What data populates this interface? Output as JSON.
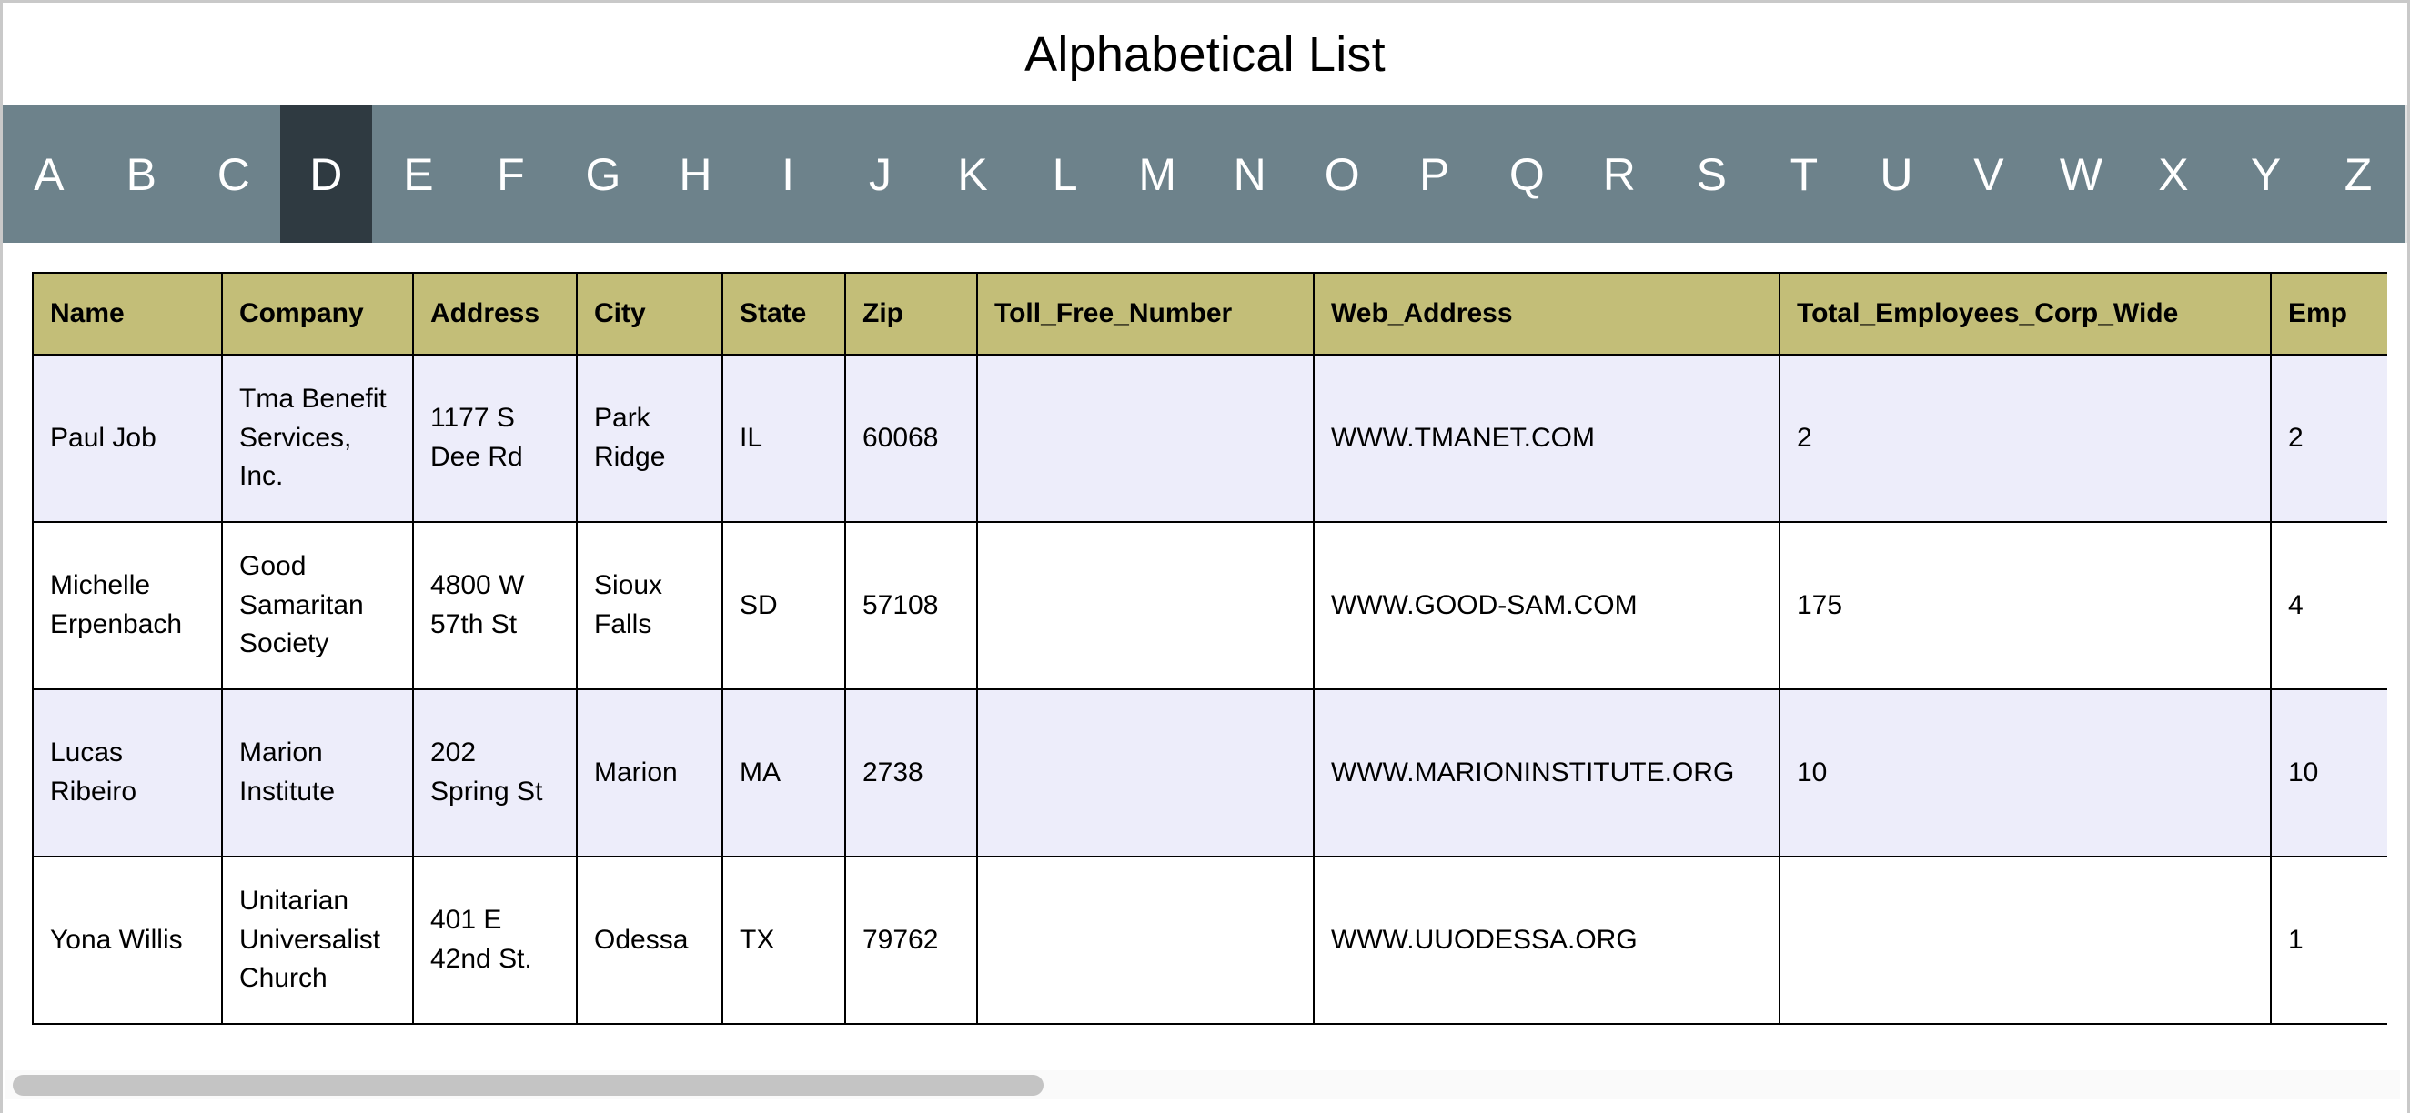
{
  "header": {
    "title": "Alphabetical List"
  },
  "alphabet_nav": {
    "active_letter": "D",
    "letters": [
      "A",
      "B",
      "C",
      "D",
      "E",
      "F",
      "G",
      "H",
      "I",
      "J",
      "K",
      "L",
      "M",
      "N",
      "O",
      "P",
      "Q",
      "R",
      "S",
      "T",
      "U",
      "V",
      "W",
      "X",
      "Y",
      "Z"
    ]
  },
  "table": {
    "columns": [
      "Name",
      "Company",
      "Address",
      "City",
      "State",
      "Zip",
      "Toll_Free_Number",
      "Web_Address",
      "Total_Employees_Corp_Wide",
      "Emp"
    ],
    "rows": [
      {
        "name": "Paul Job",
        "company": "Tma Benefit Services, Inc.",
        "address": "1177 S Dee Rd",
        "city": "Park Ridge",
        "state": "IL",
        "zip": "60068",
        "toll_free_number": "",
        "web_address": "WWW.TMANET.COM",
        "total_employees_corp_wide": "2",
        "emp": "2"
      },
      {
        "name": "Michelle Erpenbach",
        "company": "Good Samaritan Society",
        "address": "4800 W 57th St",
        "city": "Sioux Falls",
        "state": "SD",
        "zip": "57108",
        "toll_free_number": "",
        "web_address": "WWW.GOOD-SAM.COM",
        "total_employees_corp_wide": "175",
        "emp": "4"
      },
      {
        "name": "Lucas Ribeiro",
        "company": "Marion Institute",
        "address": "202 Spring St",
        "city": "Marion",
        "state": "MA",
        "zip": "2738",
        "toll_free_number": "",
        "web_address": "WWW.MARIONINSTITUTE.ORG",
        "total_employees_corp_wide": "10",
        "emp": "10"
      },
      {
        "name": "Yona Willis",
        "company": "Unitarian Universalist Church",
        "address": "401 E 42nd St.",
        "city": "Odessa",
        "state": "TX",
        "zip": "79762",
        "toll_free_number": "",
        "web_address": "WWW.UUODESSA.ORG",
        "total_employees_corp_wide": "",
        "emp": "1"
      }
    ]
  },
  "colors": {
    "nav_background": "#6d828b",
    "nav_active": "#2f3a41",
    "header_row": "#c3be78",
    "row_alt": "#ededfa",
    "scrollbar_thumb": "#c4c4c4"
  }
}
